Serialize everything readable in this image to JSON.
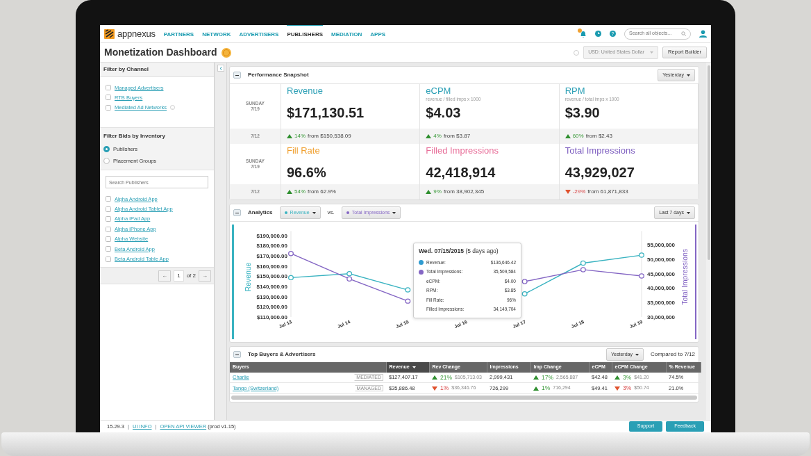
{
  "nav": {
    "logo": "appnexus",
    "items": [
      {
        "label": "PARTNERS",
        "selected": false
      },
      {
        "label": "NETWORK",
        "selected": false
      },
      {
        "label": "ADVERTISERS",
        "selected": false
      },
      {
        "label": "PUBLISHERS",
        "selected": true
      },
      {
        "label": "MEDIATION",
        "selected": false
      },
      {
        "label": "APPS",
        "selected": false
      }
    ],
    "search": {
      "placeholder": "Search all objects..."
    }
  },
  "header": {
    "title": "Monetization Dashboard",
    "currency": {
      "value": "USD: United States Dollar",
      "disabled": true
    },
    "button": "Report Builder"
  },
  "sidebar": {
    "channel": {
      "title": "Filter by Channel",
      "options": [
        {
          "label": "Managed Advertisers",
          "checked": false,
          "help": false
        },
        {
          "label": "RTB Buyers",
          "checked": false,
          "help": false
        },
        {
          "label": "Mediated Ad Networks",
          "checked": false,
          "help": true
        }
      ]
    },
    "inventory": {
      "title": "Filter Bids by Inventory",
      "options": [
        {
          "label": "Publishers",
          "selected": true
        },
        {
          "label": "Placement Groups",
          "selected": false
        }
      ]
    },
    "search": {
      "placeholder": "Search Publishers"
    },
    "publishers": [
      {
        "label": "Alpha Android App",
        "checked": false
      },
      {
        "label": "Alpha Android Tablet App",
        "checked": false
      },
      {
        "label": "Alpha iPad App",
        "checked": false
      },
      {
        "label": "Alpha iPhone App",
        "checked": false
      },
      {
        "label": "Alpha Website",
        "checked": false
      },
      {
        "label": "Beta Android App",
        "checked": false
      },
      {
        "label": "Beta Android Table App",
        "checked": false
      }
    ],
    "pager": {
      "prev": "←",
      "page": "1",
      "of": "of 2",
      "next": "→"
    }
  },
  "snapshot": {
    "title": "Performance Snapshot",
    "range": "Yesterday",
    "rows": [
      {
        "day": "SUNDAY",
        "date": "7/19",
        "compare": "7/12",
        "metrics": [
          {
            "title": "Revenue",
            "color": "#2a9fb5",
            "value": "$171,130.51",
            "change": {
              "rising": true,
              "pct": "14%",
              "text": "from $150,538.09"
            }
          },
          {
            "title": "eCPM",
            "subtitle": "revenue / filled imps x 1000",
            "color": "#2a9fb5",
            "value": "$4.03",
            "change": {
              "rising": true,
              "pct": "4%",
              "text": "from $3.87"
            }
          },
          {
            "title": "RPM",
            "subtitle": "revenue / total imps x 1000",
            "color": "#2a9fb5",
            "value": "$3.90",
            "change": {
              "rising": true,
              "pct": "60%",
              "text": "from $2.43"
            }
          }
        ]
      },
      {
        "day": "SUNDAY",
        "date": "7/19",
        "compare": "7/12",
        "metrics": [
          {
            "title": "Fill Rate",
            "color": "#f0a030",
            "value": "96.6%",
            "change": {
              "rising": true,
              "pct": "54%",
              "text": "from 62.9%"
            }
          },
          {
            "title": "Filled Impressions",
            "color": "#e8709a",
            "value": "42,418,914",
            "change": {
              "rising": true,
              "pct": "9%",
              "text": "from 38,902,345"
            }
          },
          {
            "title": "Total Impressions",
            "color": "#7e5fc0",
            "value": "43,929,027",
            "change": {
              "rising": false,
              "pct": "-29%",
              "text": "from 61,871,833"
            }
          }
        ]
      }
    ]
  },
  "analytics": {
    "title": "Analytics",
    "vs": "vs.",
    "range": "Last 7 days",
    "chart_data": {
      "type": "line",
      "ylabel": "Revenue",
      "y2label": "Total Impressions",
      "categories": [
        "Jul 13",
        "Jul 14",
        "Jul 15",
        "Jul 16",
        "Jul 17",
        "Jul 18",
        "Jul 19"
      ],
      "series": [
        {
          "name": "Revenue",
          "color": "#3ab3c1",
          "marker": "circle",
          "values": [
            148700,
            152600,
            136600,
            null,
            132700,
            163000,
            170800
          ]
        },
        {
          "name": "Total Impressions",
          "color": "#8466c4",
          "marker": "circle",
          "axis": "y2",
          "values": [
            52000000,
            43200000,
            35500000,
            null,
            42300000,
            46400000,
            44200000
          ]
        }
      ],
      "ylim": [
        110000,
        190000
      ],
      "yticks": [
        {
          "value": 110000,
          "label": "$110,000.00"
        },
        {
          "value": 120000,
          "label": "$120,000.00"
        },
        {
          "value": 130000,
          "label": "$130,000.00"
        },
        {
          "value": 140000,
          "label": "$140,000.00"
        },
        {
          "value": 150000,
          "label": "$150,000.00"
        },
        {
          "value": 160000,
          "label": "$160,000.00"
        },
        {
          "value": 170000,
          "label": "$170,000.00"
        },
        {
          "value": 180000,
          "label": "$180,000.00"
        },
        {
          "value": 190000,
          "label": "$190,000.00"
        }
      ],
      "y2lim": [
        30000000,
        55000000
      ],
      "y2ticks": [
        {
          "value": 30000000,
          "label": "30,000,000"
        },
        {
          "value": 35000000,
          "label": "35,000,000"
        },
        {
          "value": 40000000,
          "label": "40,000,000"
        },
        {
          "value": 45000000,
          "label": "45,000,000"
        },
        {
          "value": 50000000,
          "label": "50,000,000"
        },
        {
          "value": 55000000,
          "label": "55,000,000"
        }
      ]
    },
    "tooltip": {
      "title": "Wed. 07/15/2015",
      "note": "(5 days ago)",
      "rows": [
        {
          "label": "Revenue:",
          "value": "$136,646.42",
          "color": "#2f9bd0"
        },
        {
          "label": "Total Impressions:",
          "value": "35,509,584",
          "color": "#8466c4"
        },
        {
          "label": "eCPM:",
          "value": "$4.00"
        },
        {
          "label": "RPM:",
          "value": "$3.85"
        },
        {
          "label": "Fill Rate:",
          "value": "96%"
        },
        {
          "label": "Filled Impressions:",
          "value": "34,149,704"
        }
      ]
    }
  },
  "buyers": {
    "title": "Top Buyers & Advertisers",
    "range": "Yesterday",
    "compare": "Compared to 7/12",
    "columns": [
      {
        "label": "Buyers",
        "sorted": false
      },
      {
        "label": "Revenue",
        "sorted": true
      },
      {
        "label": "Rev Change",
        "sorted": false
      },
      {
        "label": "Impressions",
        "sorted": false
      },
      {
        "label": "Imp Change",
        "sorted": false
      },
      {
        "label": "eCPM",
        "sorted": false
      },
      {
        "label": "eCPM Change",
        "sorted": false
      },
      {
        "label": "% Revenue",
        "sorted": false
      }
    ],
    "rows": [
      {
        "name": "Charlie",
        "tag": "MEDIATED",
        "revenue": "$127,407.17",
        "rev_change": {
          "rising": true,
          "pct": "21%",
          "prev": "$105,713.03"
        },
        "impressions": "2,999,431",
        "imp_change": {
          "rising": true,
          "pct": "17%",
          "prev": "2,565,887"
        },
        "ecpm": "$42.48",
        "ecpm_change": {
          "rising": true,
          "pct": "3%",
          "prev": "$41.20"
        },
        "share": "74.5%"
      },
      {
        "name": "Tango (Switzerland)",
        "tag": "MANAGED",
        "revenue": "$35,886.48",
        "rev_change": {
          "rising": false,
          "pct": "1%",
          "prev": "$36,346.76"
        },
        "impressions": "726,299",
        "imp_change": {
          "rising": true,
          "pct": "1%",
          "prev": "716,294"
        },
        "ecpm": "$49.41",
        "ecpm_change": {
          "rising": false,
          "pct": "3%",
          "prev": "$50.74"
        },
        "share": "21.0%"
      }
    ]
  },
  "footer": {
    "version": "15.29.3",
    "separator_1": "|",
    "link_1": "UI INFO",
    "separator_2": "|",
    "link_2": "OPEN API VIEWER",
    "env": "(prod v1.15)",
    "buttons": [
      "Support",
      "Feedback"
    ]
  }
}
